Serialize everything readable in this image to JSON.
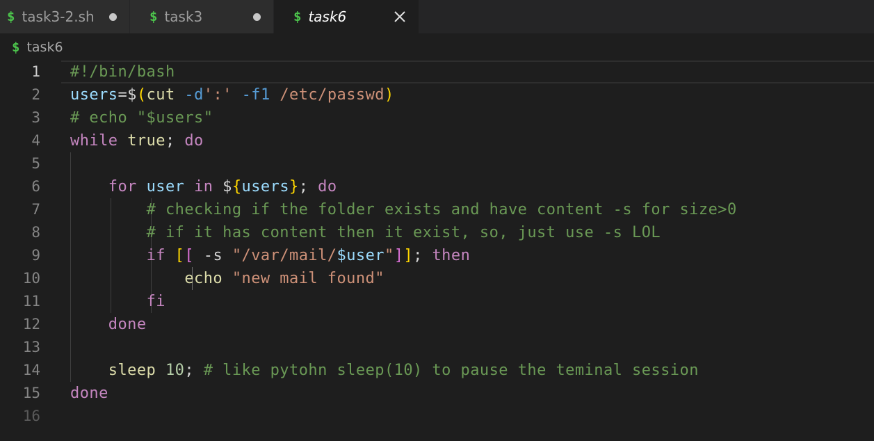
{
  "tabs": [
    {
      "icon": "$",
      "label": "task3-2.sh",
      "state": "modified"
    },
    {
      "icon": "$",
      "label": "task3",
      "state": "modified"
    },
    {
      "icon": "$",
      "label": "task6",
      "state": "active"
    }
  ],
  "breadcrumb": {
    "icon": "$",
    "label": "task6"
  },
  "editor": {
    "current_line": 1,
    "lines": [
      {
        "n": "1",
        "tokens": [
          {
            "t": "#!/bin/bash",
            "c": "comment"
          }
        ]
      },
      {
        "n": "2",
        "tokens": [
          {
            "t": "users",
            "c": "var"
          },
          {
            "t": "=$",
            "c": "plain"
          },
          {
            "t": "(",
            "c": "yellow"
          },
          {
            "t": "cut",
            "c": "func"
          },
          {
            "t": " ",
            "c": "plain"
          },
          {
            "t": "-d",
            "c": "flag"
          },
          {
            "t": "':'",
            "c": "string"
          },
          {
            "t": " ",
            "c": "plain"
          },
          {
            "t": "-f1",
            "c": "flag"
          },
          {
            "t": " /etc/passwd",
            "c": "string"
          },
          {
            "t": ")",
            "c": "yellow"
          }
        ]
      },
      {
        "n": "3",
        "tokens": [
          {
            "t": "# echo \"$users\"",
            "c": "comment"
          }
        ]
      },
      {
        "n": "4",
        "tokens": [
          {
            "t": "while",
            "c": "keyword"
          },
          {
            "t": " ",
            "c": "plain"
          },
          {
            "t": "true",
            "c": "func"
          },
          {
            "t": "; ",
            "c": "plain"
          },
          {
            "t": "do",
            "c": "keyword"
          }
        ]
      },
      {
        "n": "5",
        "tokens": []
      },
      {
        "n": "6",
        "tokens": [
          {
            "t": "    ",
            "c": "plain"
          },
          {
            "t": "for",
            "c": "keyword"
          },
          {
            "t": " ",
            "c": "plain"
          },
          {
            "t": "user",
            "c": "var"
          },
          {
            "t": " ",
            "c": "plain"
          },
          {
            "t": "in",
            "c": "keyword"
          },
          {
            "t": " $",
            "c": "plain"
          },
          {
            "t": "{",
            "c": "yellow"
          },
          {
            "t": "users",
            "c": "var"
          },
          {
            "t": "}",
            "c": "yellow"
          },
          {
            "t": "; ",
            "c": "plain"
          },
          {
            "t": "do",
            "c": "keyword"
          }
        ]
      },
      {
        "n": "7",
        "tokens": [
          {
            "t": "        ",
            "c": "plain"
          },
          {
            "t": "# checking if the folder exists and have content -s for size>0",
            "c": "comment"
          }
        ]
      },
      {
        "n": "8",
        "tokens": [
          {
            "t": "        ",
            "c": "plain"
          },
          {
            "t": "# if it has content then it exist, so, just use -s LOL",
            "c": "comment"
          }
        ]
      },
      {
        "n": "9",
        "tokens": [
          {
            "t": "        ",
            "c": "plain"
          },
          {
            "t": "if",
            "c": "keyword"
          },
          {
            "t": " ",
            "c": "plain"
          },
          {
            "t": "[",
            "c": "yellow"
          },
          {
            "t": "[",
            "c": "bracket2"
          },
          {
            "t": " -s ",
            "c": "plain"
          },
          {
            "t": "\"/var/mail/",
            "c": "string"
          },
          {
            "t": "$user",
            "c": "var"
          },
          {
            "t": "\"",
            "c": "string"
          },
          {
            "t": "]",
            "c": "bracket2"
          },
          {
            "t": "]",
            "c": "yellow"
          },
          {
            "t": "; ",
            "c": "plain"
          },
          {
            "t": "then",
            "c": "keyword"
          }
        ]
      },
      {
        "n": "10",
        "tokens": [
          {
            "t": "            ",
            "c": "plain"
          },
          {
            "t": "echo",
            "c": "func"
          },
          {
            "t": " ",
            "c": "plain"
          },
          {
            "t": "\"new mail found\"",
            "c": "string"
          }
        ]
      },
      {
        "n": "11",
        "tokens": [
          {
            "t": "        ",
            "c": "plain"
          },
          {
            "t": "fi",
            "c": "keyword"
          }
        ]
      },
      {
        "n": "12",
        "tokens": [
          {
            "t": "    ",
            "c": "plain"
          },
          {
            "t": "done",
            "c": "keyword"
          }
        ]
      },
      {
        "n": "13",
        "tokens": []
      },
      {
        "n": "14",
        "tokens": [
          {
            "t": "    ",
            "c": "plain"
          },
          {
            "t": "sleep",
            "c": "func"
          },
          {
            "t": " ",
            "c": "plain"
          },
          {
            "t": "10",
            "c": "number"
          },
          {
            "t": "; ",
            "c": "plain"
          },
          {
            "t": "# like pytohn sleep(10) to pause the teminal session",
            "c": "comment"
          }
        ]
      },
      {
        "n": "15",
        "tokens": [
          {
            "t": "done",
            "c": "keyword"
          }
        ]
      },
      {
        "n": "16",
        "tokens": []
      }
    ]
  }
}
